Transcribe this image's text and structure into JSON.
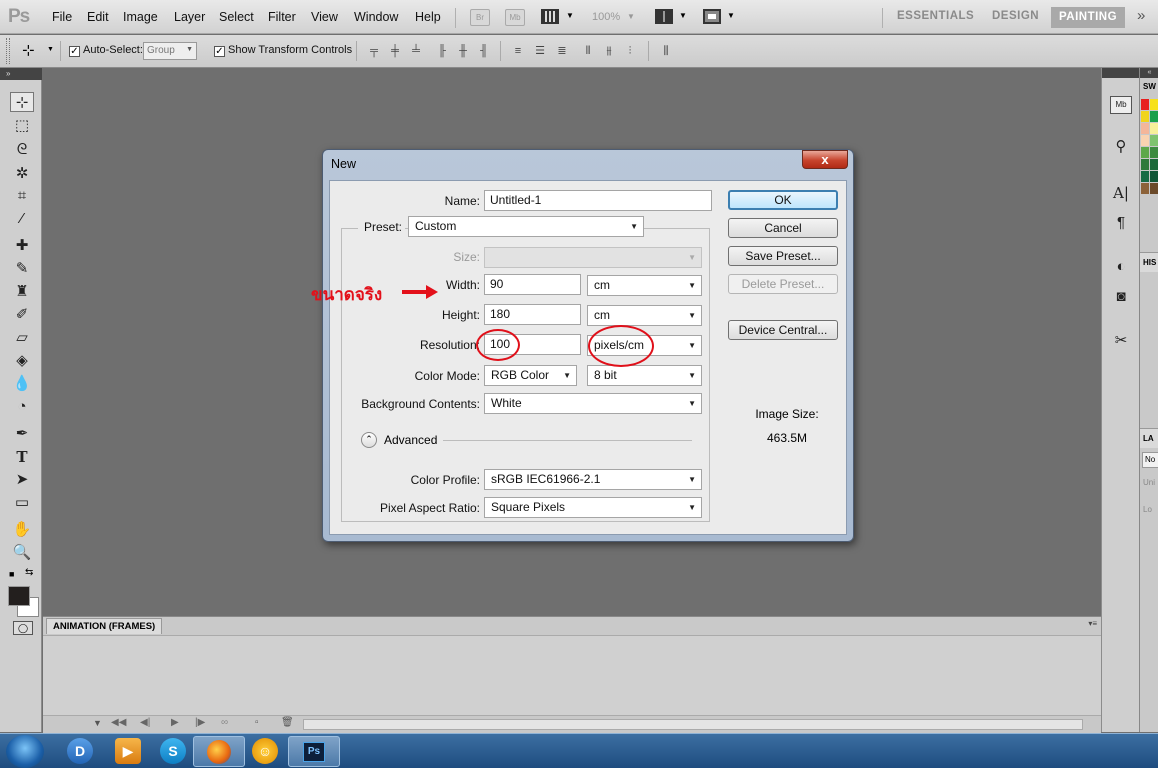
{
  "app": {
    "logo": "Ps",
    "menu": [
      "File",
      "Edit",
      "Image",
      "Layer",
      "Select",
      "Filter",
      "View",
      "Window",
      "Help"
    ],
    "zoom": "100%",
    "workspaces": [
      "ESSENTIALS",
      "DESIGN",
      "PAINTING"
    ],
    "active_workspace": "PAINTING",
    "overflow": "»"
  },
  "options_bar": {
    "auto_select_label": "Auto-Select:",
    "auto_select_checked": true,
    "auto_select_value": "Group",
    "show_transform_label": "Show Transform Controls",
    "show_transform_checked": true
  },
  "dialog": {
    "title": "New",
    "close": "x",
    "name_label": "Name:",
    "name_value": "Untitled-1",
    "preset_label": "Preset:",
    "preset_value": "Custom",
    "size_label": "Size:",
    "size_value": "",
    "width_label": "Width:",
    "width_value": "90",
    "width_unit": "cm",
    "height_label": "Height:",
    "height_value": "180",
    "height_unit": "cm",
    "resolution_label": "Resolution:",
    "resolution_value": "100",
    "resolution_unit": "pixels/cm",
    "color_mode_label": "Color Mode:",
    "color_mode_value": "RGB Color",
    "bit_depth_value": "8 bit",
    "background_label": "Background Contents:",
    "background_value": "White",
    "advanced_label": "Advanced",
    "color_profile_label": "Color Profile:",
    "color_profile_value": "sRGB IEC61966-2.1",
    "pixel_aspect_label": "Pixel Aspect Ratio:",
    "pixel_aspect_value": "Square Pixels",
    "buttons": {
      "ok": "OK",
      "cancel": "Cancel",
      "save_preset": "Save Preset...",
      "delete_preset": "Delete Preset...",
      "device_central": "Device Central..."
    },
    "image_size_label": "Image Size:",
    "image_size_value": "463.5M"
  },
  "annotation": {
    "text": "ขนาดจริง",
    "color": "#e3101a"
  },
  "panels": {
    "animation_tab": "ANIMATION (FRAMES)",
    "right_swatches_tab": "SW",
    "right_history_tab": "HIS",
    "right_layers_tab": "LA",
    "right_layers_blend": "No",
    "right_layers_unify": "Uni",
    "right_layers_lock": "Lo"
  },
  "colors": {
    "accent_red": "#e3101a",
    "dialog_frame": "#a8bad1",
    "taskbar": "#2a5a8e"
  }
}
